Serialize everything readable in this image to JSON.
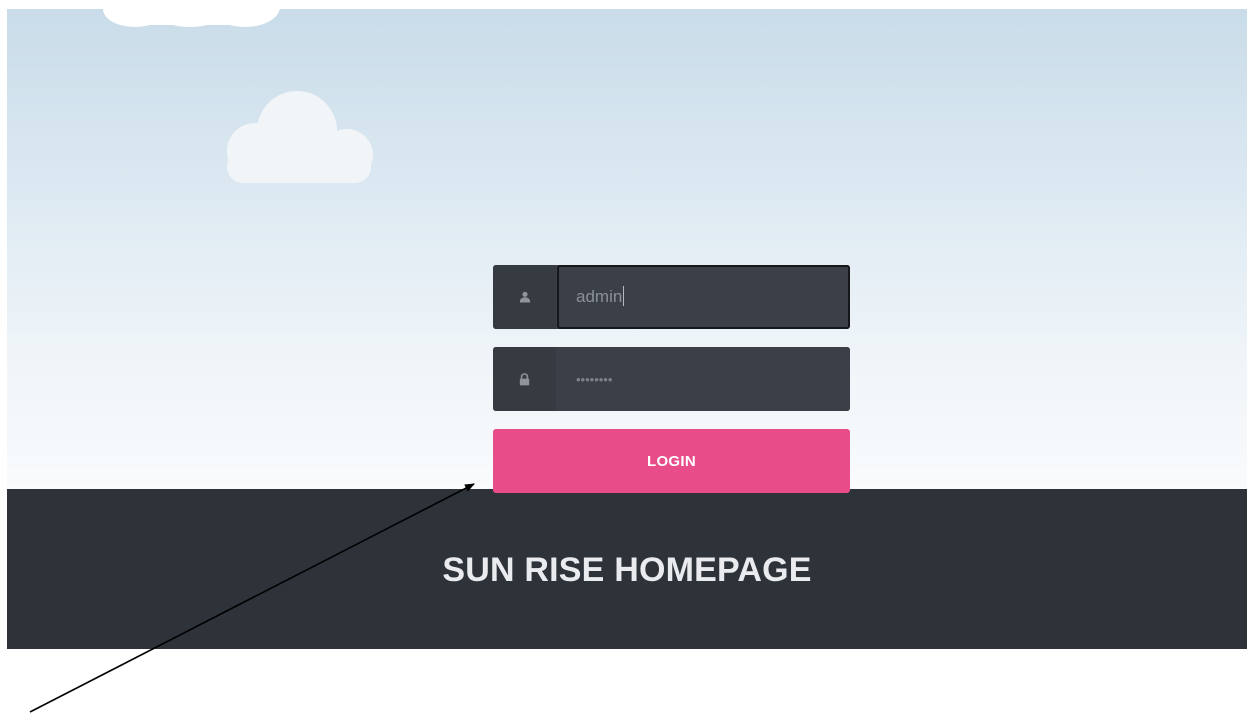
{
  "login_form": {
    "username_value": "admin",
    "password_masked": "••••••••",
    "login_label": "LOGIN"
  },
  "footer": {
    "title": "SUN RISE HOMEPAGE"
  },
  "colors": {
    "button": "#e84c89",
    "field": "#3b4048",
    "band": "#2e3239"
  },
  "icons": {
    "username": "user-icon",
    "password": "lock-icon"
  }
}
